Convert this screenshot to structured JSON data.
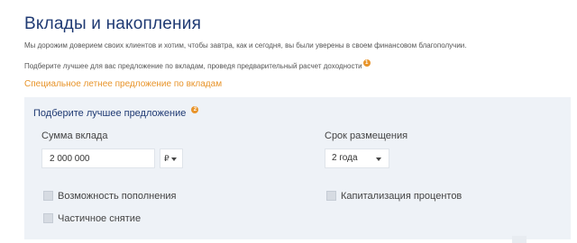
{
  "page": {
    "title": "Вклады и накопления",
    "intro": "Мы дорожим доверием своих клиентов и хотим, чтобы завтра, как и сегодня, вы были уверены в своем финансовом благополучии.",
    "hint": "Подберите лучшее для вас предложение по вкладам, проведя предварительный расчет доходности",
    "hint_badge": "1",
    "offer_link": "Специальное летнее предложение по вкладам"
  },
  "calculator": {
    "title": "Подберите лучшее предложение",
    "title_badge": "2",
    "amount_label": "Сумма вклада",
    "amount_value": "2 000 000",
    "currency": "₽",
    "term_label": "Срок размещения",
    "term_value": "2 года",
    "options": {
      "replenish": "Возможность пополнения",
      "partial_withdrawal": "Частичное снятие",
      "capitalization": "Капитализация процентов"
    }
  },
  "colors": {
    "title": "#1f3a73",
    "accent": "#e8942a",
    "panel_bg": "#eef2f7"
  }
}
